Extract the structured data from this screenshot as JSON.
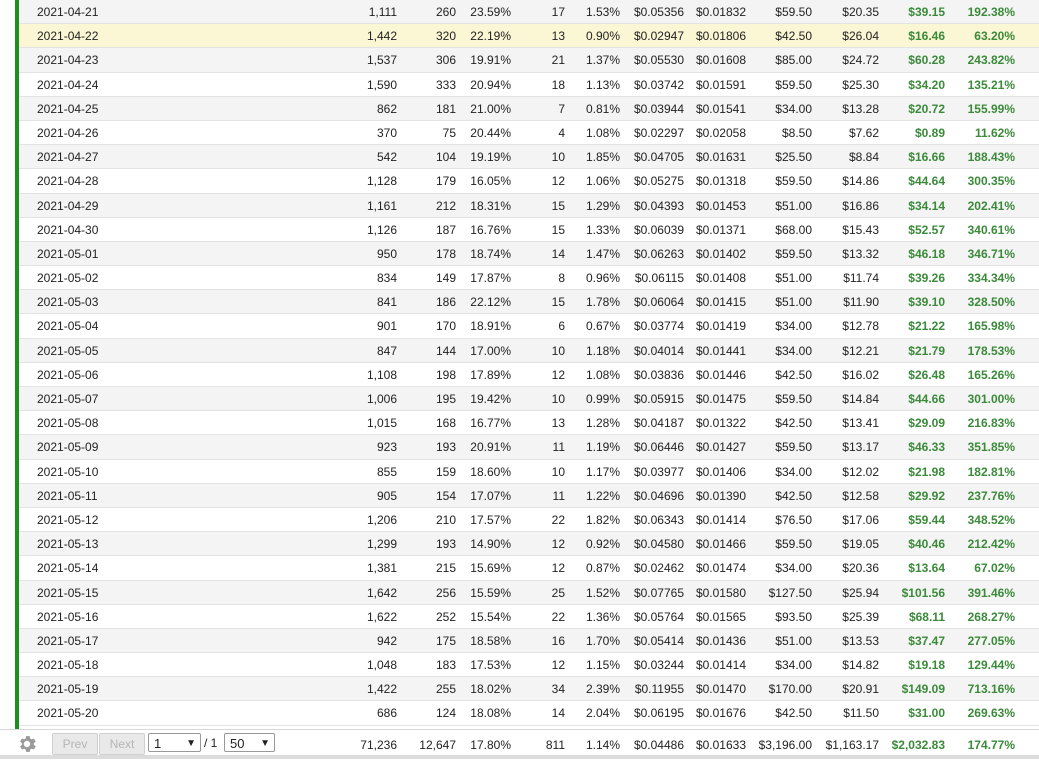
{
  "rows": [
    [
      "2021-04-21",
      "1,111",
      "260",
      "23.59%",
      "17",
      "1.53%",
      "$0.05356",
      "$0.01832",
      "$59.50",
      "$20.35",
      "$39.15",
      "192.38%"
    ],
    [
      "2021-04-22",
      "1,442",
      "320",
      "22.19%",
      "13",
      "0.90%",
      "$0.02947",
      "$0.01806",
      "$42.50",
      "$26.04",
      "$16.46",
      "63.20%"
    ],
    [
      "2021-04-23",
      "1,537",
      "306",
      "19.91%",
      "21",
      "1.37%",
      "$0.05530",
      "$0.01608",
      "$85.00",
      "$24.72",
      "$60.28",
      "243.82%"
    ],
    [
      "2021-04-24",
      "1,590",
      "333",
      "20.94%",
      "18",
      "1.13%",
      "$0.03742",
      "$0.01591",
      "$59.50",
      "$25.30",
      "$34.20",
      "135.21%"
    ],
    [
      "2021-04-25",
      "862",
      "181",
      "21.00%",
      "7",
      "0.81%",
      "$0.03944",
      "$0.01541",
      "$34.00",
      "$13.28",
      "$20.72",
      "155.99%"
    ],
    [
      "2021-04-26",
      "370",
      "75",
      "20.44%",
      "4",
      "1.08%",
      "$0.02297",
      "$0.02058",
      "$8.50",
      "$7.62",
      "$0.89",
      "11.62%"
    ],
    [
      "2021-04-27",
      "542",
      "104",
      "19.19%",
      "10",
      "1.85%",
      "$0.04705",
      "$0.01631",
      "$25.50",
      "$8.84",
      "$16.66",
      "188.43%"
    ],
    [
      "2021-04-28",
      "1,128",
      "179",
      "16.05%",
      "12",
      "1.06%",
      "$0.05275",
      "$0.01318",
      "$59.50",
      "$14.86",
      "$44.64",
      "300.35%"
    ],
    [
      "2021-04-29",
      "1,161",
      "212",
      "18.31%",
      "15",
      "1.29%",
      "$0.04393",
      "$0.01453",
      "$51.00",
      "$16.86",
      "$34.14",
      "202.41%"
    ],
    [
      "2021-04-30",
      "1,126",
      "187",
      "16.76%",
      "15",
      "1.33%",
      "$0.06039",
      "$0.01371",
      "$68.00",
      "$15.43",
      "$52.57",
      "340.61%"
    ],
    [
      "2021-05-01",
      "950",
      "178",
      "18.74%",
      "14",
      "1.47%",
      "$0.06263",
      "$0.01402",
      "$59.50",
      "$13.32",
      "$46.18",
      "346.71%"
    ],
    [
      "2021-05-02",
      "834",
      "149",
      "17.87%",
      "8",
      "0.96%",
      "$0.06115",
      "$0.01408",
      "$51.00",
      "$11.74",
      "$39.26",
      "334.34%"
    ],
    [
      "2021-05-03",
      "841",
      "186",
      "22.12%",
      "15",
      "1.78%",
      "$0.06064",
      "$0.01415",
      "$51.00",
      "$11.90",
      "$39.10",
      "328.50%"
    ],
    [
      "2021-05-04",
      "901",
      "170",
      "18.91%",
      "6",
      "0.67%",
      "$0.03774",
      "$0.01419",
      "$34.00",
      "$12.78",
      "$21.22",
      "165.98%"
    ],
    [
      "2021-05-05",
      "847",
      "144",
      "17.00%",
      "10",
      "1.18%",
      "$0.04014",
      "$0.01441",
      "$34.00",
      "$12.21",
      "$21.79",
      "178.53%"
    ],
    [
      "2021-05-06",
      "1,108",
      "198",
      "17.89%",
      "12",
      "1.08%",
      "$0.03836",
      "$0.01446",
      "$42.50",
      "$16.02",
      "$26.48",
      "165.26%"
    ],
    [
      "2021-05-07",
      "1,006",
      "195",
      "19.42%",
      "10",
      "0.99%",
      "$0.05915",
      "$0.01475",
      "$59.50",
      "$14.84",
      "$44.66",
      "301.00%"
    ],
    [
      "2021-05-08",
      "1,015",
      "168",
      "16.77%",
      "13",
      "1.28%",
      "$0.04187",
      "$0.01322",
      "$42.50",
      "$13.41",
      "$29.09",
      "216.83%"
    ],
    [
      "2021-05-09",
      "923",
      "193",
      "20.91%",
      "11",
      "1.19%",
      "$0.06446",
      "$0.01427",
      "$59.50",
      "$13.17",
      "$46.33",
      "351.85%"
    ],
    [
      "2021-05-10",
      "855",
      "159",
      "18.60%",
      "10",
      "1.17%",
      "$0.03977",
      "$0.01406",
      "$34.00",
      "$12.02",
      "$21.98",
      "182.81%"
    ],
    [
      "2021-05-11",
      "905",
      "154",
      "17.07%",
      "11",
      "1.22%",
      "$0.04696",
      "$0.01390",
      "$42.50",
      "$12.58",
      "$29.92",
      "237.76%"
    ],
    [
      "2021-05-12",
      "1,206",
      "210",
      "17.57%",
      "22",
      "1.82%",
      "$0.06343",
      "$0.01414",
      "$76.50",
      "$17.06",
      "$59.44",
      "348.52%"
    ],
    [
      "2021-05-13",
      "1,299",
      "193",
      "14.90%",
      "12",
      "0.92%",
      "$0.04580",
      "$0.01466",
      "$59.50",
      "$19.05",
      "$40.46",
      "212.42%"
    ],
    [
      "2021-05-14",
      "1,381",
      "215",
      "15.69%",
      "12",
      "0.87%",
      "$0.02462",
      "$0.01474",
      "$34.00",
      "$20.36",
      "$13.64",
      "67.02%"
    ],
    [
      "2021-05-15",
      "1,642",
      "256",
      "15.59%",
      "25",
      "1.52%",
      "$0.07765",
      "$0.01580",
      "$127.50",
      "$25.94",
      "$101.56",
      "391.46%"
    ],
    [
      "2021-05-16",
      "1,622",
      "252",
      "15.54%",
      "22",
      "1.36%",
      "$0.05764",
      "$0.01565",
      "$93.50",
      "$25.39",
      "$68.11",
      "268.27%"
    ],
    [
      "2021-05-17",
      "942",
      "175",
      "18.58%",
      "16",
      "1.70%",
      "$0.05414",
      "$0.01436",
      "$51.00",
      "$13.53",
      "$37.47",
      "277.05%"
    ],
    [
      "2021-05-18",
      "1,048",
      "183",
      "17.53%",
      "12",
      "1.15%",
      "$0.03244",
      "$0.01414",
      "$34.00",
      "$14.82",
      "$19.18",
      "129.44%"
    ],
    [
      "2021-05-19",
      "1,422",
      "255",
      "18.02%",
      "34",
      "2.39%",
      "$0.11955",
      "$0.01470",
      "$170.00",
      "$20.91",
      "$149.09",
      "713.16%"
    ],
    [
      "2021-05-20",
      "686",
      "124",
      "18.08%",
      "14",
      "2.04%",
      "$0.06195",
      "$0.01676",
      "$42.50",
      "$11.50",
      "$31.00",
      "269.63%"
    ]
  ],
  "highlighted_row_index": 1,
  "footer": {
    "prev_label": "Prev",
    "next_label": "Next",
    "page_value": "1",
    "page_total": "/ 1",
    "page_size_value": "50",
    "totals": [
      "71,236",
      "12,647",
      "17.80%",
      "811",
      "1.14%",
      "$0.04486",
      "$0.01633",
      "$3,196.00",
      "$1,163.17",
      "$2,032.83",
      "174.77%"
    ]
  },
  "icons": {
    "settings": "gear-icon",
    "dropdown": "chevron-down-icon"
  },
  "colors": {
    "accent_bar": "#1e8e1e",
    "positive": "#3a8a3a",
    "highlight": "#fbf6d4"
  }
}
